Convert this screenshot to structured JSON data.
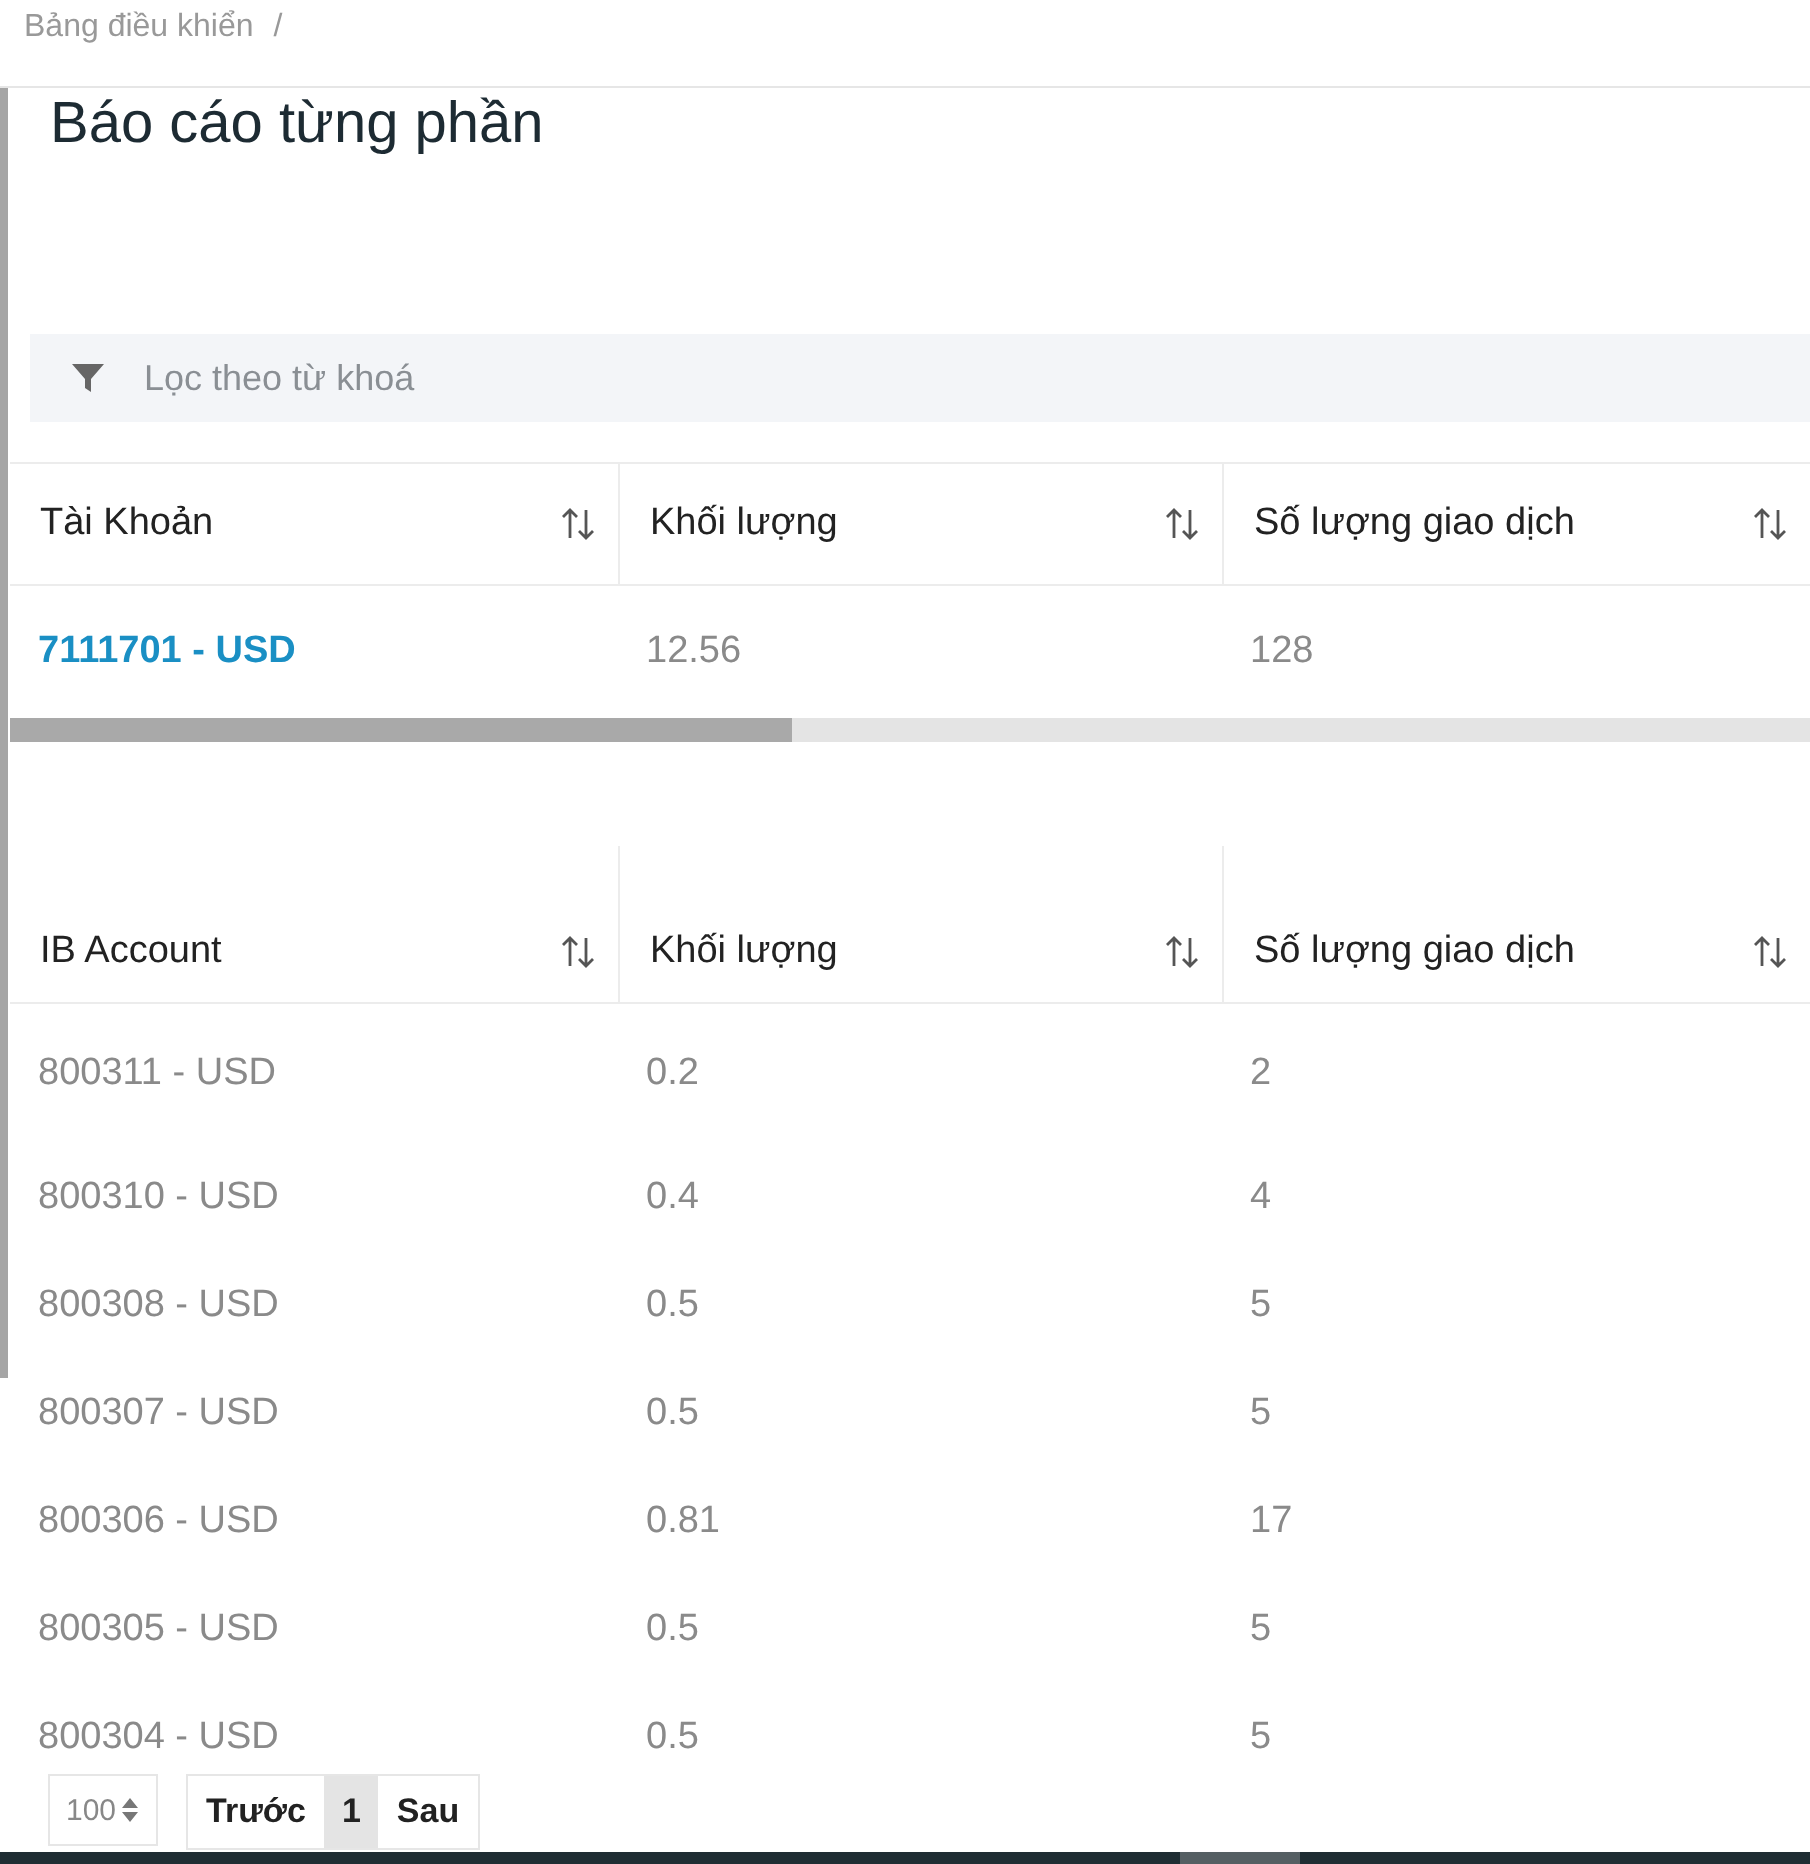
{
  "breadcrumb": {
    "items": [
      "Bảng điều khiển"
    ],
    "separator": "/"
  },
  "page_title": "Báo cáo từng phần",
  "filter": {
    "placeholder": "Lọc theo từ khoá"
  },
  "account_table": {
    "columns": [
      "Tài Khoản",
      "Khối lượng",
      "Số lượng giao dịch"
    ],
    "rows": [
      {
        "kind": "link",
        "cells": [
          "7111701 - USD",
          "12.56",
          "128"
        ]
      }
    ]
  },
  "ib_table": {
    "columns": [
      "IB Account",
      "Khối lượng",
      "Số lượng giao dịch"
    ],
    "rows": [
      {
        "kind": "plain",
        "cells": [
          "800311 - USD",
          "0.2",
          "2"
        ]
      },
      {
        "kind": "plain",
        "cells": [
          "800310 - USD",
          "0.4",
          "4"
        ]
      },
      {
        "kind": "plain",
        "cells": [
          "800308 - USD",
          "0.5",
          "5"
        ]
      },
      {
        "kind": "plain",
        "cells": [
          "800307 - USD",
          "0.5",
          "5"
        ]
      },
      {
        "kind": "plain",
        "cells": [
          "800306 - USD",
          "0.81",
          "17"
        ]
      },
      {
        "kind": "plain",
        "cells": [
          "800305 - USD",
          "0.5",
          "5"
        ]
      },
      {
        "kind": "plain",
        "cells": [
          "800304 - USD",
          "0.5",
          "5"
        ]
      }
    ]
  },
  "pagination": {
    "page_size": "100",
    "pages": [
      {
        "label": "Trước",
        "selected": false
      },
      {
        "label": "1",
        "selected": true
      },
      {
        "label": "Sau",
        "selected": false
      }
    ]
  }
}
